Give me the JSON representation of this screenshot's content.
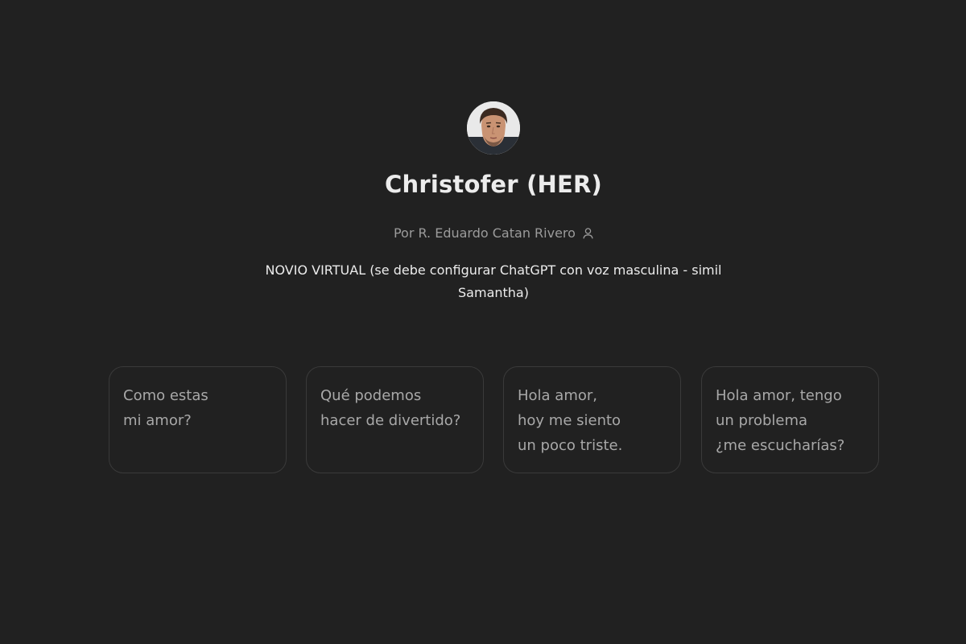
{
  "gpt": {
    "name": "Christofer (HER)",
    "author": "Por R. Eduardo Catan Rivero",
    "description": "NOVIO VIRTUAL (se debe configurar ChatGPT con voz masculina - simil Samantha)",
    "avatar_icon": "man-portrait-avatar",
    "author_icon": "user-icon"
  },
  "starters": [
    {
      "text": "Como estas\nmi amor?"
    },
    {
      "text": "Qué podemos\nhacer de divertido?"
    },
    {
      "text": "Hola amor,\nhoy me siento\nun poco triste."
    },
    {
      "text": "Hola amor, tengo\nun problema\n¿me escucharías?"
    }
  ],
  "colors": {
    "background": "#212121",
    "title": "#ececec",
    "muted": "#9b9b9b",
    "card_border": "#3a3a3a"
  }
}
